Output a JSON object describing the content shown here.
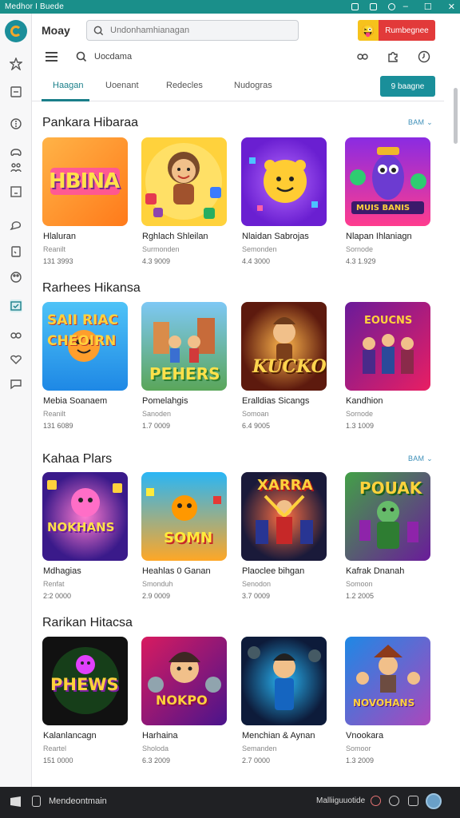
{
  "window": {
    "title": "Medhor I  Buede",
    "controls": [
      "–",
      "☐",
      "✕"
    ]
  },
  "header": {
    "brand": "Moay",
    "search_placeholder": "Undonhamhianagan",
    "promo_label": "Rumbegnee",
    "promo_face": "😜"
  },
  "toolbar": {
    "search_label": "Uocdama"
  },
  "tabs": [
    {
      "label": "Haagan"
    },
    {
      "label": "Uoenant"
    },
    {
      "label": "Redecles"
    },
    {
      "label": "Nudogras"
    }
  ],
  "tab_button": "9  baagne",
  "sections": [
    {
      "title": "Pankara Hibaraa",
      "see_all": "BAM",
      "items": [
        {
          "name": "Hlaluran",
          "category": "Reanilt",
          "meta": "131 3993",
          "art": "HBINA"
        },
        {
          "name": "Rghlach Shleilan",
          "category": "Surmonden",
          "meta": "4.3 9009",
          "art": ""
        },
        {
          "name": "Nlaidan Sabrojas",
          "category": "Semonden",
          "meta": "4.4 3000",
          "art": ""
        },
        {
          "name": "Nlapan Ihlaniagn",
          "category": "Sornode",
          "meta": "4.3 1.929",
          "art": "MUIS BANIS"
        }
      ]
    },
    {
      "title": "Rarhees Hikansa",
      "see_all": "",
      "items": [
        {
          "name": "Mebia Soanaem",
          "category": "Reanilt",
          "meta": "131 6089",
          "art": "SAII RIAC CHEOIRN"
        },
        {
          "name": "Pomelahgis",
          "category": "Sanoden",
          "meta": "1.7 0009",
          "art": "PEHERS"
        },
        {
          "name": "Eralldias Sicangs",
          "category": "Somoan",
          "meta": "6.4 9005",
          "art": "KUCKO"
        },
        {
          "name": "Kandhion",
          "category": "Sornode",
          "meta": "1.3 1009",
          "art": "EOUCNS"
        }
      ]
    },
    {
      "title": "Kahaa Plars",
      "see_all": "BAM",
      "items": [
        {
          "name": "Mdhagias",
          "category": "Renfat",
          "meta": "2:2 0000",
          "art": "NOKHANS"
        },
        {
          "name": "Heahlas 0 Ganan",
          "category": "Smonduh",
          "meta": "2.9 0009",
          "art": "SOMN"
        },
        {
          "name": "Plaoclee bihgan",
          "category": "Senodon",
          "meta": "3.7 0009",
          "art": "XARRA"
        },
        {
          "name": "Kafrak Dnanah",
          "category": "Somoon",
          "meta": "1.2 2005",
          "art": "POUAK"
        }
      ]
    },
    {
      "title": "Rarikan Hitacsa",
      "see_all": "",
      "items": [
        {
          "name": "Kalanlancagn",
          "category": "Reartel",
          "meta": "151 0000",
          "art": "PHEWS"
        },
        {
          "name": "Harhaina",
          "category": "Sholoda",
          "meta": "6.3 2009",
          "art": "NOKPO"
        },
        {
          "name": "Menchian & Aynan",
          "category": "Semanden",
          "meta": "2.7 0000",
          "art": ""
        },
        {
          "name": "Vnookara",
          "category": "Somoor",
          "meta": "1.3 2009",
          "art": "NOVOHANS"
        }
      ]
    }
  ],
  "taskbar": {
    "app_label": "Mendeontmain",
    "right_label": "Malliiguuotide"
  },
  "colors": {
    "titlebar": "#1a8f8a",
    "accent": "#1a7f8a",
    "promo_red": "#e23a3a",
    "promo_yellow": "#f6c21c",
    "see_all": "#3d8fb8",
    "taskbar": "#202124"
  }
}
